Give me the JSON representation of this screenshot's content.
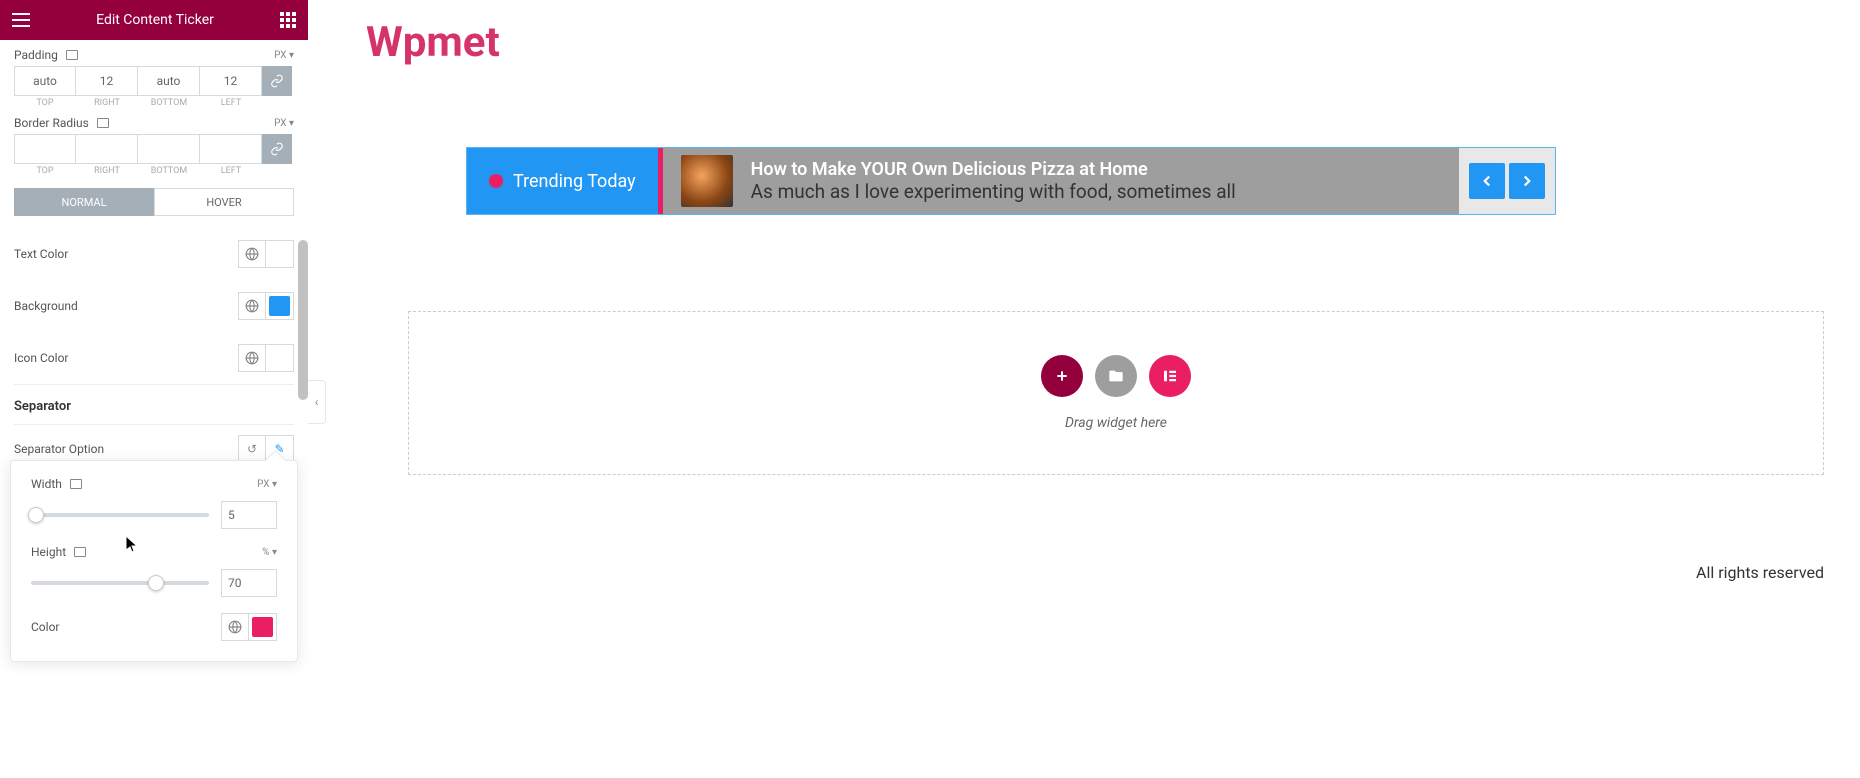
{
  "header": {
    "title": "Edit Content Ticker"
  },
  "panel": {
    "padding": {
      "label": "Padding",
      "unit": "PX",
      "top": "auto",
      "right": "12",
      "bottom": "auto",
      "left": "12",
      "sides": [
        "TOP",
        "RIGHT",
        "BOTTOM",
        "LEFT"
      ]
    },
    "border_radius": {
      "label": "Border Radius",
      "unit": "PX",
      "top": "",
      "right": "",
      "bottom": "",
      "left": "",
      "sides": [
        "TOP",
        "RIGHT",
        "BOTTOM",
        "LEFT"
      ]
    },
    "tabs": {
      "normal": "NORMAL",
      "hover": "HOVER"
    },
    "text_color": {
      "label": "Text Color"
    },
    "background": {
      "label": "Background",
      "swatch": "#2196f3"
    },
    "icon_color": {
      "label": "Icon Color"
    },
    "separator": {
      "title": "Separator",
      "option_label": "Separator Option"
    },
    "popover": {
      "width": {
        "label": "Width",
        "unit": "PX",
        "value": "5",
        "pct": 3
      },
      "height": {
        "label": "Height",
        "unit": "%",
        "value": "70",
        "pct": 70
      },
      "color": {
        "label": "Color",
        "swatch": "#e91e63"
      }
    }
  },
  "preview": {
    "brand": "Wpmet",
    "ticker": {
      "badge": "Trending Today",
      "title": "How to Make YOUR Own Delicious Pizza at Home",
      "sub": "As much as I love experimenting with food, sometimes all"
    },
    "dropzone": "Drag widget here",
    "footer": "All rights reserved"
  }
}
